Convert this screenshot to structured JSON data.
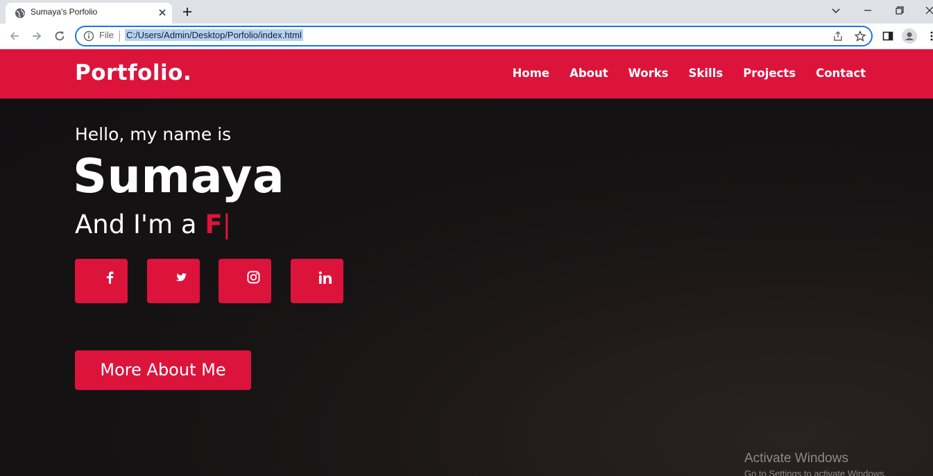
{
  "browser": {
    "tab_title": "Sumaya's Porfolio",
    "url_scheme": "File",
    "url": "C:/Users/Admin/Desktop/Porfolio/index.html"
  },
  "site": {
    "logo": "Portfolio.",
    "nav": [
      "Home",
      "About",
      "Works",
      "Skills",
      "Projects",
      "Contact"
    ],
    "hero": {
      "greeting": "Hello, my name is",
      "name": "Sumaya",
      "role_prefix": "And I'm a",
      "role_typed": "F",
      "cursor": "|"
    },
    "socials": [
      "facebook-icon",
      "twitter-icon",
      "instagram-icon",
      "linkedin-icon"
    ],
    "cta": "More About Me"
  },
  "os_watermark": {
    "title": "Activate Windows",
    "subtitle": "Go to Settings to activate Windows."
  },
  "colors": {
    "accent": "#dc143c",
    "hero_bg": "#141213",
    "text": "#ffffff"
  }
}
